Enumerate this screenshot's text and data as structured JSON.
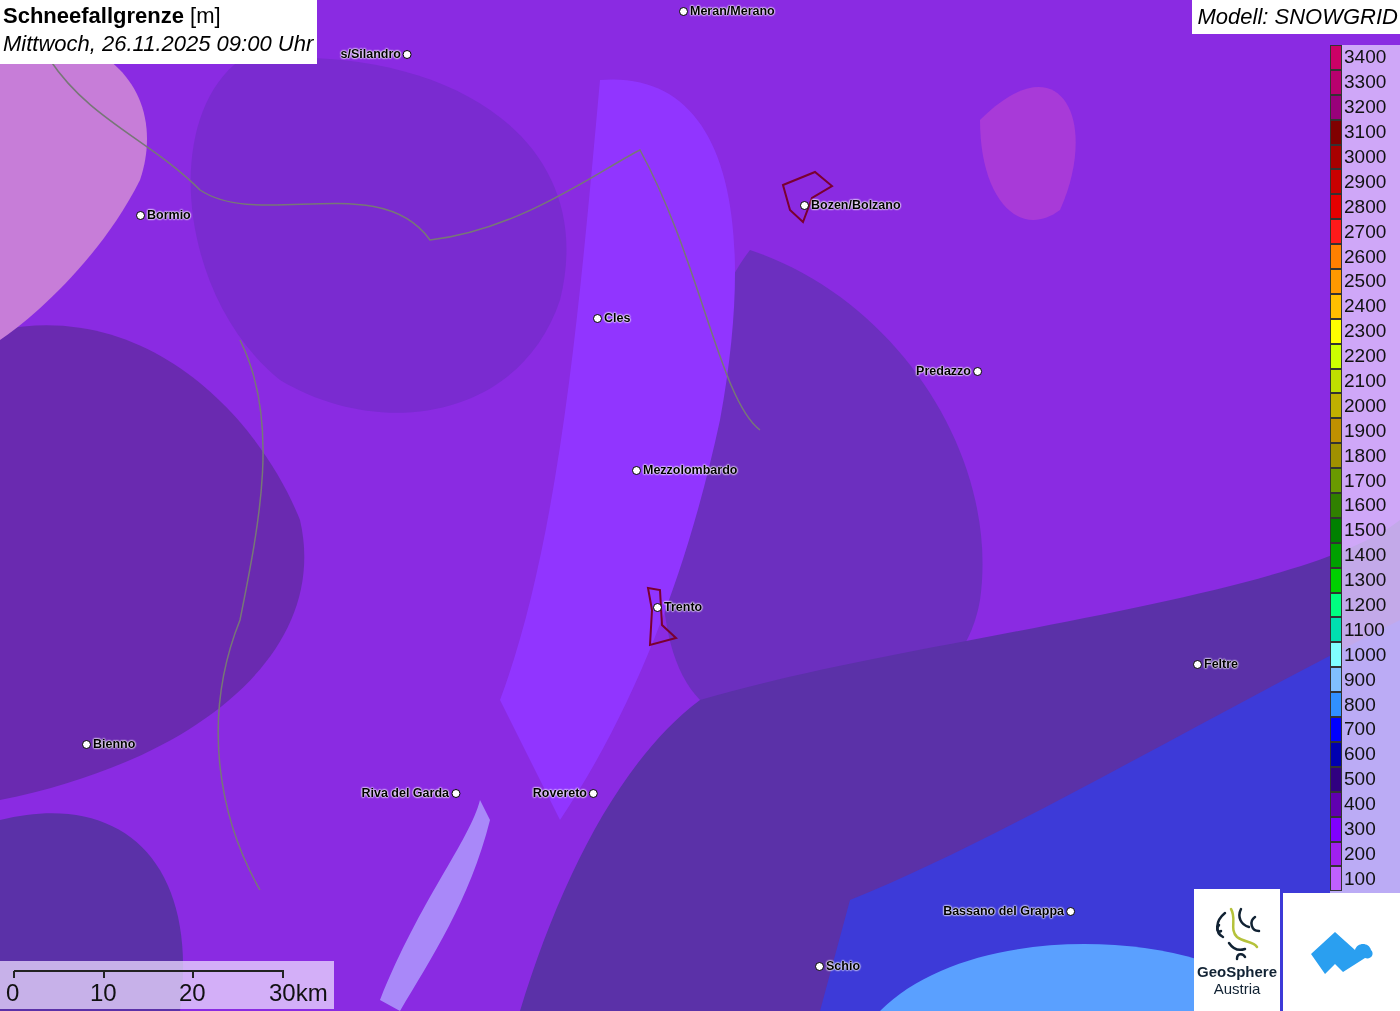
{
  "title": "**Schneefallgrenze** [m]",
  "subtitle": "Mittwoch, 26.11.2025 09:00 Uhr",
  "model": "Modell: SNOWGRID",
  "cities": [
    {
      "name": "Meran/Merano"
    },
    {
      "name": "s/Silandro"
    },
    {
      "name": "Bormio"
    },
    {
      "name": "Bozen/Bolzano"
    },
    {
      "name": "Cles"
    },
    {
      "name": "Predazzo"
    },
    {
      "name": "Mezzolombardo"
    },
    {
      "name": "Trento"
    },
    {
      "name": "Feltre"
    },
    {
      "name": "Bienno"
    },
    {
      "name": "Riva del Garda"
    },
    {
      "name": "Rovereto"
    },
    {
      "name": "Bassano del Grappa"
    },
    {
      "name": "Schio"
    }
  ],
  "legend": [
    {
      "label": "3400",
      "color": "#cc0066"
    },
    {
      "label": "3300",
      "color": "#b8006e"
    },
    {
      "label": "3200",
      "color": "#99007a"
    },
    {
      "label": "3100",
      "color": "#800000"
    },
    {
      "label": "3000",
      "color": "#a80000"
    },
    {
      "label": "2900",
      "color": "#c80000"
    },
    {
      "label": "2800",
      "color": "#e60000"
    },
    {
      "label": "2700",
      "color": "#ff1a1a"
    },
    {
      "label": "2600",
      "color": "#ff8000"
    },
    {
      "label": "2500",
      "color": "#ff9900"
    },
    {
      "label": "2400",
      "color": "#ffbf00"
    },
    {
      "label": "2300",
      "color": "#ffff00"
    },
    {
      "label": "2200",
      "color": "#ccff00"
    },
    {
      "label": "2100",
      "color": "#bfdf00"
    },
    {
      "label": "2000",
      "color": "#c0b000"
    },
    {
      "label": "1900",
      "color": "#c09000"
    },
    {
      "label": "1800",
      "color": "#a09000"
    },
    {
      "label": "1700",
      "color": "#6a9a00"
    },
    {
      "label": "1600",
      "color": "#308000"
    },
    {
      "label": "1500",
      "color": "#008000"
    },
    {
      "label": "1400",
      "color": "#00a000"
    },
    {
      "label": "1300",
      "color": "#00d000"
    },
    {
      "label": "1200",
      "color": "#00ff80"
    },
    {
      "label": "1100",
      "color": "#00e0b0"
    },
    {
      "label": "1000",
      "color": "#80ffff"
    },
    {
      "label": "900",
      "color": "#80c0ff"
    },
    {
      "label": "800",
      "color": "#3090ff"
    },
    {
      "label": "700",
      "color": "#0000ff"
    },
    {
      "label": "600",
      "color": "#0000b0"
    },
    {
      "label": "500",
      "color": "#300080"
    },
    {
      "label": "400",
      "color": "#6000b0"
    },
    {
      "label": "300",
      "color": "#8000ff"
    },
    {
      "label": "200",
      "color": "#a020f0"
    },
    {
      "label": "100",
      "color": "#c060ff"
    }
  ],
  "scale": [
    "0",
    "10",
    "20",
    "30km"
  ],
  "logo": {
    "name": "GeoSphere",
    "sub": "Austria"
  }
}
